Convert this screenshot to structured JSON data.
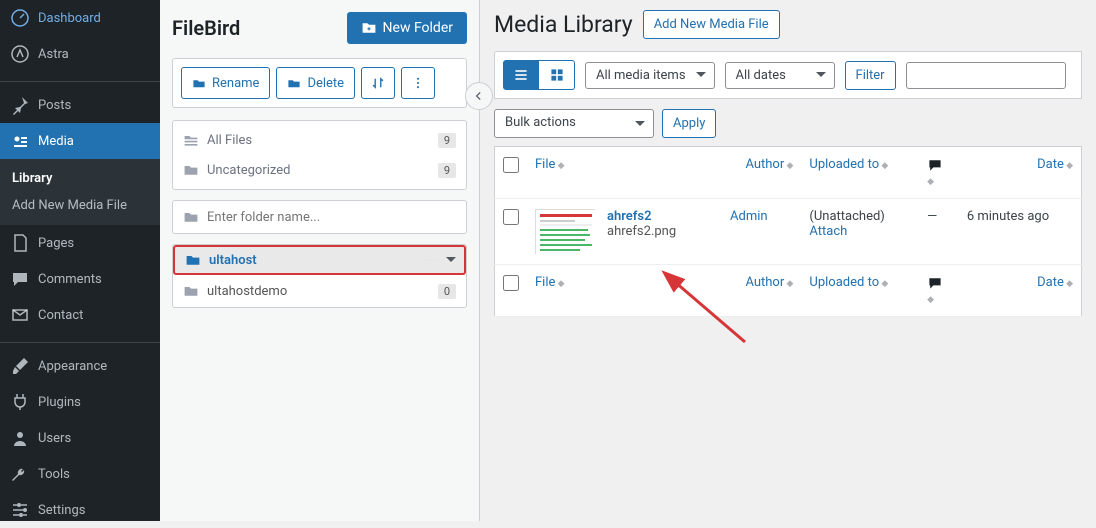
{
  "sidebar": {
    "items": [
      {
        "label": "Dashboard"
      },
      {
        "label": "Astra"
      },
      {
        "label": "Posts"
      },
      {
        "label": "Media"
      },
      {
        "label": "Pages"
      },
      {
        "label": "Comments"
      },
      {
        "label": "Contact"
      },
      {
        "label": "Appearance"
      },
      {
        "label": "Plugins"
      },
      {
        "label": "Users"
      },
      {
        "label": "Tools"
      },
      {
        "label": "Settings"
      }
    ],
    "sub": {
      "library": "Library",
      "addnew": "Add New Media File"
    }
  },
  "filebird": {
    "title": "FileBird",
    "new_folder": "New Folder",
    "rename": "Rename",
    "delete": "Delete",
    "allfiles": {
      "label": "All Files",
      "count": "9"
    },
    "uncat": {
      "label": "Uncategorized",
      "count": "9"
    },
    "search_placeholder": "Enter folder name...",
    "folders": [
      {
        "name": "ultahost",
        "count": ""
      },
      {
        "name": "ultahostdemo",
        "count": "0"
      }
    ]
  },
  "main": {
    "title": "Media Library",
    "addnew": "Add New Media File",
    "filter_media": "All media items",
    "filter_dates": "All dates",
    "filter_btn": "Filter",
    "bulk": "Bulk actions",
    "apply": "Apply",
    "cols": {
      "file": "File",
      "author": "Author",
      "uploaded": "Uploaded to",
      "comments": "",
      "date": "Date"
    },
    "row": {
      "title": "ahrefs2",
      "filename": "ahrefs2.png",
      "author": "Admin",
      "uploaded": "(Unattached)",
      "attach": "Attach",
      "comments": "—",
      "date": "6 minutes ago"
    }
  }
}
